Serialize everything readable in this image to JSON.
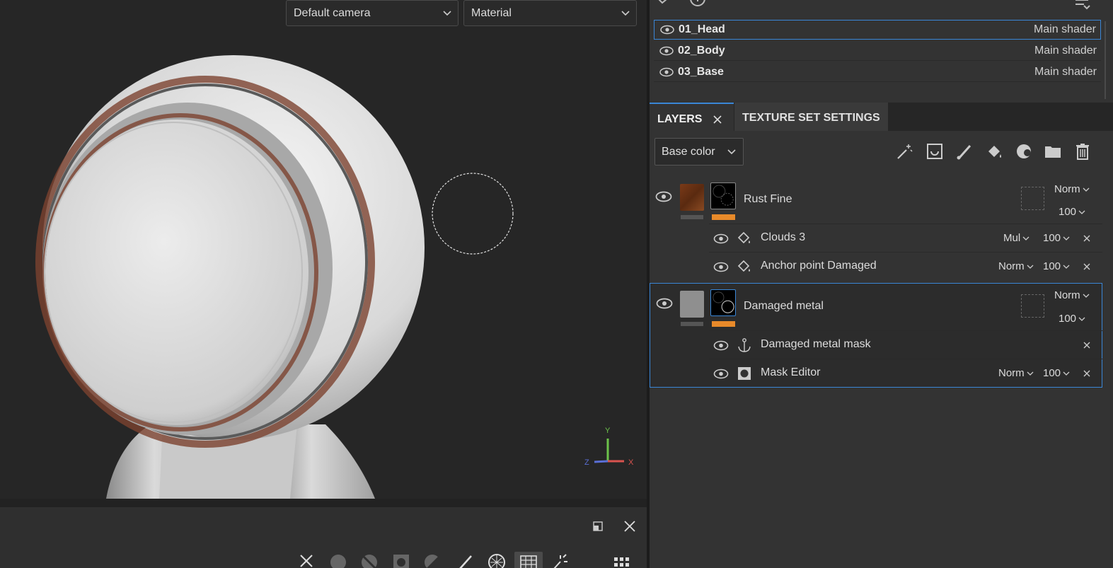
{
  "viewport": {
    "camera_select": "Default camera",
    "mode_select": "Material",
    "axis": {
      "y": "Y",
      "x": "X",
      "z": "Z"
    }
  },
  "bottom_panel": {
    "icons": [
      "close-icon",
      "sphere-icon",
      "sphere-slashed-icon",
      "mask-square-icon",
      "half-circle-icon",
      "pen-icon",
      "checker-sphere-icon",
      "grid-sliders-icon",
      "sparkle-icon",
      "apps-grid-icon"
    ]
  },
  "texture_sets": [
    {
      "name": "01_Head",
      "shader": "Main shader",
      "selected": true
    },
    {
      "name": "02_Body",
      "shader": "Main shader",
      "selected": false
    },
    {
      "name": "03_Base",
      "shader": "Main shader",
      "selected": false
    }
  ],
  "tabs": {
    "layers": "LAYERS",
    "texture_set_settings": "TEXTURE SET SETTINGS"
  },
  "channel_select": "Base color",
  "layer_tools": [
    "magic-wand-icon",
    "fill-layer-icon",
    "brush-icon",
    "paint-bucket-icon",
    "mask-icon",
    "folder-icon",
    "trash-icon"
  ],
  "layers": [
    {
      "name": "Rust Fine",
      "blend": "Norm",
      "opacity": "100",
      "effects": [
        {
          "name": "Clouds 3",
          "blend": "Mul",
          "opacity": "100",
          "icon": "fill-icon"
        },
        {
          "name": "Anchor point Damaged",
          "blend": "Norm",
          "opacity": "100",
          "icon": "fill-icon"
        }
      ]
    },
    {
      "name": "Damaged metal",
      "blend": "Norm",
      "opacity": "100",
      "selected": true,
      "effects": [
        {
          "name": "Damaged metal mask",
          "blend": "",
          "opacity": "",
          "icon": "anchor-icon"
        },
        {
          "name": "Mask Editor",
          "blend": "Norm",
          "opacity": "100",
          "icon": "mask-editor-icon"
        }
      ]
    }
  ],
  "colors": {
    "accent": "#3a86d6",
    "orange": "#e88a2a",
    "panel": "#333333",
    "viewport": "#262626"
  }
}
